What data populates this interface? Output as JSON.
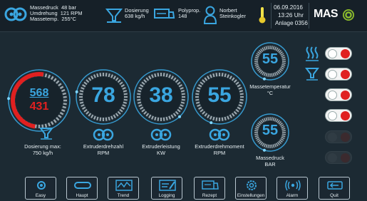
{
  "header": {
    "pressure_label": "Massedruck",
    "pressure_value": "48 bar",
    "rotation_label": "Umdrehung",
    "rotation_value": "121 RPM",
    "temp_label": "Massetemp.",
    "temp_value": "255°C",
    "dosing_label": "Dosierung",
    "dosing_value": "638 kg/h",
    "material_label": "Polyprop.",
    "material_value": "148",
    "user_first": "Norbert",
    "user_last": "Steinkogler",
    "date": "06.09.2016",
    "time": "13:26 Uhr",
    "machine": "Anlage 0356",
    "logo": "MAS"
  },
  "gauges": {
    "dosing": {
      "top": "568",
      "bottom": "431",
      "label_line1": "Dosierung max:",
      "label_line2": "750 kg/h",
      "fill": 0.76
    },
    "speed": {
      "value": "78",
      "label_line1": "Extruderdrehzahl",
      "label_line2": "RPM",
      "fill": 0.78
    },
    "power": {
      "value": "38",
      "label_line1": "Extruderleistung",
      "label_line2": "KW",
      "fill": 0.38
    },
    "torque": {
      "value": "55",
      "label_line1": "Extruderdrehmoment",
      "label_line2": "RPM",
      "fill": 0.55
    },
    "mass_temp": {
      "value": "55",
      "label_line1": "Massetemperatur",
      "label_line2": "°C",
      "fill": 0.55
    },
    "mass_pressure": {
      "value": "55",
      "label_line1": "Massedruck",
      "label_line2": "BAR",
      "fill": 0.55
    }
  },
  "colors": {
    "accent": "#3aa6e0",
    "alarm": "#e02020",
    "dial": "#9aa6ad",
    "background": "#1c2a33"
  },
  "footer": {
    "buttons": [
      "Easy",
      "Haupt",
      "Trend",
      "Logging",
      "Rezept",
      "Einstellungen",
      "Alarm",
      "Quit"
    ]
  }
}
